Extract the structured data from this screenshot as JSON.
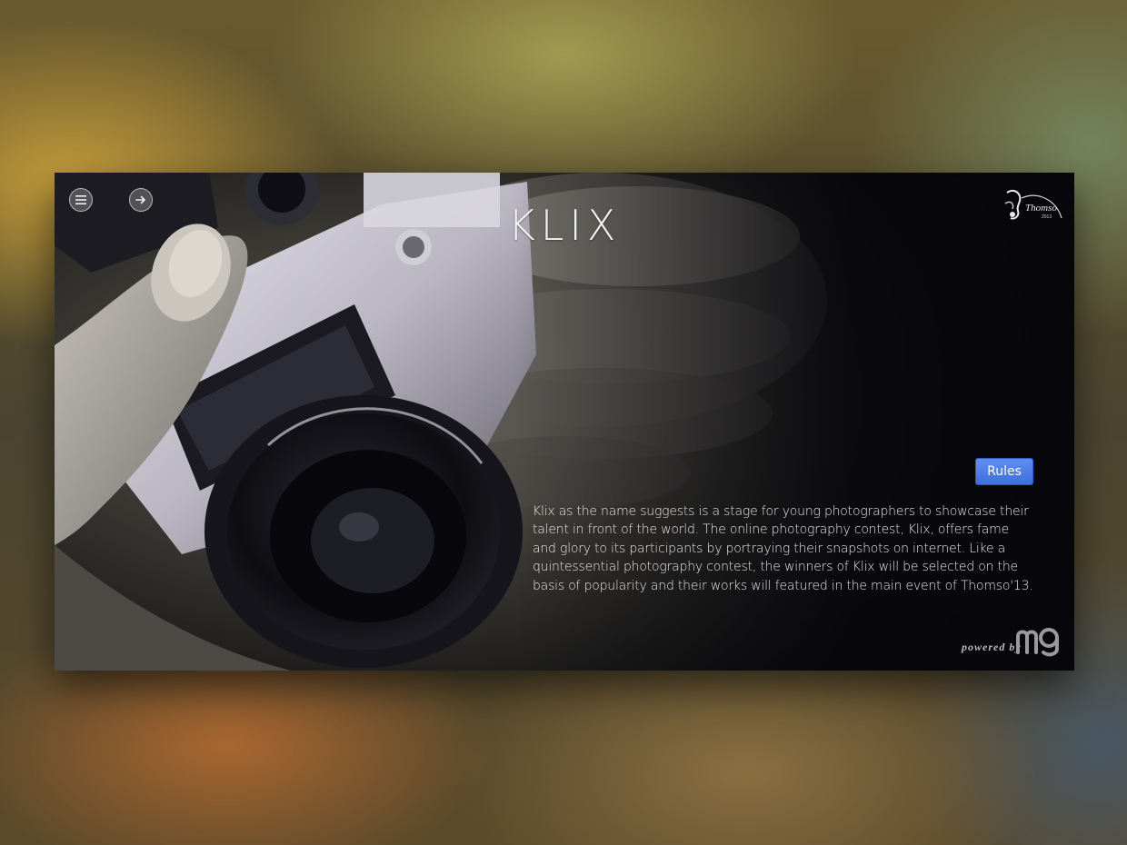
{
  "header": {
    "title": "KLIX"
  },
  "controls": {
    "menu_icon": "hamburger-menu-icon",
    "next_icon": "arrow-right-icon"
  },
  "logo": {
    "name": "Thomso",
    "year": "2013"
  },
  "main": {
    "rules_label": "Rules",
    "description": "Klix as the name suggests is a stage for young photographers to showcase their talent in front of the world. The online photography contest, Klix, offers fame and glory to its participants by portraying their snapshots on internet. Like a quintessential photography contest, the winners of Klix will be selected on the basis of popularity and their works will featured in the main event of Thomso'13."
  },
  "footer": {
    "powered_by": "powered by"
  },
  "colors": {
    "accent": "#4a7be8",
    "text": "#e6e6e6",
    "frame_background": "#07070b"
  }
}
